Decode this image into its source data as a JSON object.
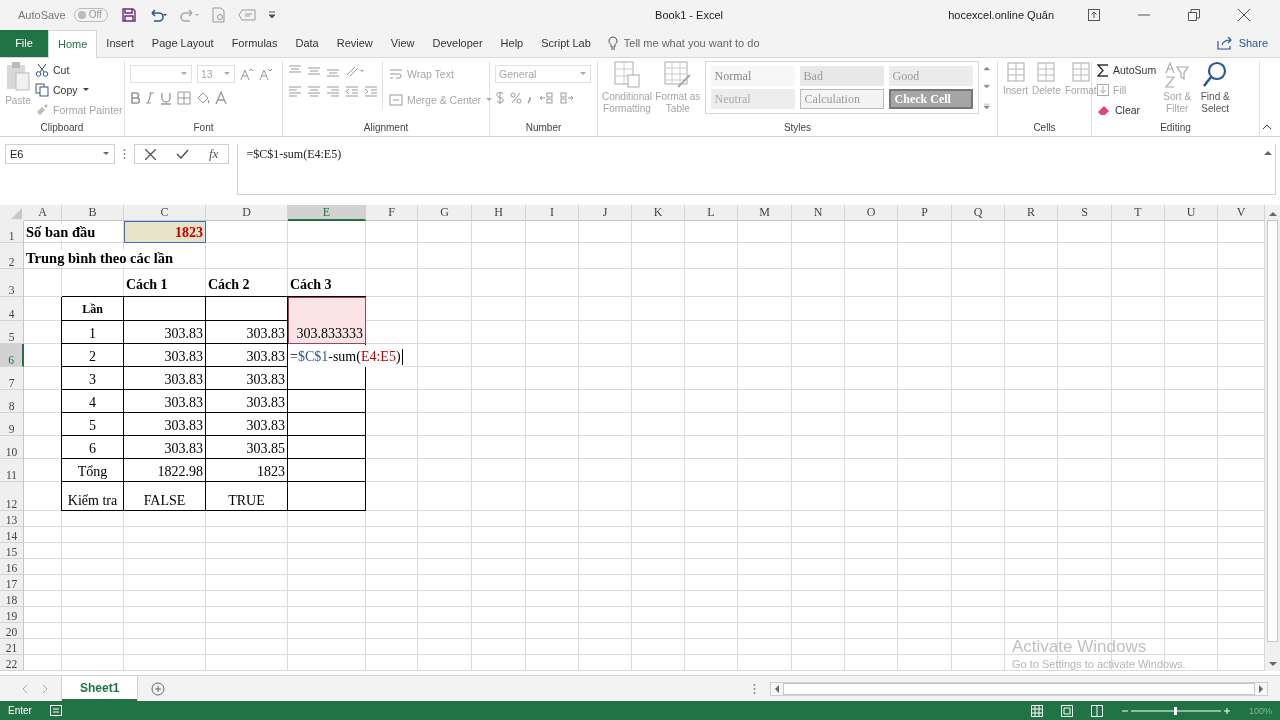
{
  "title_bar": {
    "autosave_label": "AutoSave",
    "autosave_state": "Off",
    "autosave_on": false,
    "document_title": "Book1 - Excel",
    "user": "hocexcel.online Quân"
  },
  "tabs": [
    {
      "label": "File",
      "selected": false,
      "kind": "file"
    },
    {
      "label": "Home",
      "selected": true,
      "kind": "tab"
    },
    {
      "label": "Insert",
      "selected": false,
      "kind": "tab"
    },
    {
      "label": "Page Layout",
      "selected": false,
      "kind": "tab"
    },
    {
      "label": "Formulas",
      "selected": false,
      "kind": "tab"
    },
    {
      "label": "Data",
      "selected": false,
      "kind": "tab"
    },
    {
      "label": "Review",
      "selected": false,
      "kind": "tab"
    },
    {
      "label": "View",
      "selected": false,
      "kind": "tab"
    },
    {
      "label": "Developer",
      "selected": false,
      "kind": "tab"
    },
    {
      "label": "Help",
      "selected": false,
      "kind": "tab"
    },
    {
      "label": "Script Lab",
      "selected": false,
      "kind": "tab"
    }
  ],
  "tell_me": {
    "placeholder": "Tell me what you want to do"
  },
  "share": "Share",
  "ribbon": {
    "clipboard": {
      "label": "Clipboard",
      "paste": {
        "label": "Paste",
        "disabled": true
      },
      "cut": {
        "label": "Cut",
        "disabled": false
      },
      "copy": {
        "label": "Copy",
        "disabled": false
      },
      "format_painter": {
        "label": "Format Painter",
        "disabled": true
      }
    },
    "font": {
      "label": "Font",
      "size": "13",
      "disabled": true
    },
    "alignment": {
      "label": "Alignment",
      "wrap_text": "Wrap Text",
      "merge": "Merge & Center",
      "disabled": true
    },
    "number": {
      "label": "Number",
      "format": "General",
      "disabled": true
    },
    "styles": {
      "label": "Styles",
      "conditional": "Conditional Formatting",
      "format_table": "Format as Table",
      "disabled": true,
      "cell_styles": [
        {
          "label": "Normal",
          "kind": "normal"
        },
        {
          "label": "Bad",
          "kind": "bad"
        },
        {
          "label": "Good",
          "kind": "good"
        },
        {
          "label": "Neutral",
          "kind": "neutral"
        },
        {
          "label": "Calculation",
          "kind": "calculation"
        },
        {
          "label": "Check Cell",
          "kind": "check"
        }
      ]
    },
    "cells": {
      "label": "Cells",
      "items": [
        "Insert",
        "Delete",
        "Format"
      ],
      "disabled": true
    },
    "editing": {
      "label": "Editing",
      "autosum": {
        "label": "AutoSum",
        "disabled": false
      },
      "fill": {
        "label": "Fill",
        "disabled": true
      },
      "clear": {
        "label": "Clear",
        "disabled": false
      },
      "sort": {
        "label": "Sort & Filter",
        "disabled": true
      },
      "find": {
        "label": "Find & Select",
        "disabled": false
      }
    }
  },
  "formula_bar": {
    "name_box": "E6",
    "function_label": "fx",
    "formula": "=$C$1-sum(E4:E5)"
  },
  "sheet": {
    "columns": [
      {
        "label": "A",
        "selected": false
      },
      {
        "label": "B",
        "selected": false
      },
      {
        "label": "C",
        "selected": false
      },
      {
        "label": "D",
        "selected": false
      },
      {
        "label": "E",
        "selected": true
      },
      {
        "label": "F",
        "selected": false
      },
      {
        "label": "G",
        "selected": false
      },
      {
        "label": "H",
        "selected": false
      },
      {
        "label": "I",
        "selected": false
      },
      {
        "label": "J",
        "selected": false
      },
      {
        "label": "K",
        "selected": false
      },
      {
        "label": "L",
        "selected": false
      },
      {
        "label": "M",
        "selected": false
      },
      {
        "label": "N",
        "selected": false
      },
      {
        "label": "O",
        "selected": false
      },
      {
        "label": "P",
        "selected": false
      },
      {
        "label": "Q",
        "selected": false
      },
      {
        "label": "R",
        "selected": false
      },
      {
        "label": "S",
        "selected": false
      },
      {
        "label": "T",
        "selected": false
      },
      {
        "label": "U",
        "selected": false
      },
      {
        "label": "V",
        "selected": false
      }
    ],
    "rows": [
      {
        "num": "1",
        "selected": false,
        "cells": [
          {
            "kind": "title",
            "text": "Số ban đầu"
          },
          {
            "kind": "blank"
          },
          {
            "kind": "ref",
            "text": "1823"
          }
        ]
      },
      {
        "num": "2",
        "selected": false,
        "cells": [
          {
            "kind": "title",
            "text": "Trung bình theo các lần"
          }
        ]
      },
      {
        "num": "3",
        "selected": false,
        "cells": [
          {
            "kind": "blank"
          },
          {
            "kind": "blank"
          },
          {
            "kind": "heading",
            "text": "Cách 1"
          },
          {
            "kind": "heading",
            "text": "Cách 2"
          },
          {
            "kind": "heading",
            "text": "Cách 3"
          }
        ]
      },
      {
        "num": "4",
        "selected": false,
        "cells": [
          {
            "kind": "blank"
          },
          {
            "kind": "label",
            "text": "Lần"
          },
          {
            "kind": "blank"
          },
          {
            "kind": "blank"
          },
          {
            "kind": "range"
          }
        ]
      },
      {
        "num": "5",
        "selected": false,
        "cells": [
          {
            "kind": "blank"
          },
          {
            "kind": "center",
            "text": "1"
          },
          {
            "kind": "number",
            "text": "303.83"
          },
          {
            "kind": "number",
            "text": "303.83"
          },
          {
            "kind": "range",
            "text": "303.833333"
          }
        ]
      },
      {
        "num": "6",
        "selected": true,
        "cells": [
          {
            "kind": "blank"
          },
          {
            "kind": "center",
            "text": "2"
          },
          {
            "kind": "number",
            "text": "303.83"
          },
          {
            "kind": "number",
            "text": "303.83"
          },
          {
            "kind": "editing",
            "parts": [
              {
                "text": "="
              },
              {
                "text": "$C$1",
                "color": "#2f5597"
              },
              {
                "text": "-sum("
              },
              {
                "text": "E4:E5",
                "color": "#c00000"
              },
              {
                "text": ")"
              }
            ]
          }
        ]
      },
      {
        "num": "7",
        "selected": false,
        "cells": [
          {
            "kind": "blank"
          },
          {
            "kind": "center",
            "text": "3"
          },
          {
            "kind": "number",
            "text": "303.83"
          },
          {
            "kind": "number",
            "text": "303.83"
          }
        ]
      },
      {
        "num": "8",
        "selected": false,
        "cells": [
          {
            "kind": "blank"
          },
          {
            "kind": "center",
            "text": "4"
          },
          {
            "kind": "number",
            "text": "303.83"
          },
          {
            "kind": "number",
            "text": "303.83"
          }
        ]
      },
      {
        "num": "9",
        "selected": false,
        "cells": [
          {
            "kind": "blank"
          },
          {
            "kind": "center",
            "text": "5"
          },
          {
            "kind": "number",
            "text": "303.83"
          },
          {
            "kind": "number",
            "text": "303.83"
          }
        ]
      },
      {
        "num": "10",
        "selected": false,
        "cells": [
          {
            "kind": "blank"
          },
          {
            "kind": "center",
            "text": "6"
          },
          {
            "kind": "number",
            "text": "303.83"
          },
          {
            "kind": "number",
            "text": "303.85"
          }
        ]
      },
      {
        "num": "11",
        "selected": false,
        "cells": [
          {
            "kind": "blank"
          },
          {
            "kind": "center",
            "text": "Tổng"
          },
          {
            "kind": "number",
            "text": "1822.98"
          },
          {
            "kind": "number",
            "text": "1823"
          }
        ]
      },
      {
        "num": "12",
        "selected": false,
        "cells": [
          {
            "kind": "blank"
          },
          {
            "kind": "center",
            "text": "Kiểm tra"
          },
          {
            "kind": "center",
            "text": "FALSE"
          },
          {
            "kind": "center",
            "text": "TRUE"
          }
        ]
      },
      {
        "num": "13",
        "selected": false,
        "cells": []
      },
      {
        "num": "14",
        "selected": false,
        "cells": []
      },
      {
        "num": "15",
        "selected": false,
        "cells": []
      },
      {
        "num": "16",
        "selected": false,
        "cells": []
      },
      {
        "num": "17",
        "selected": false,
        "cells": []
      },
      {
        "num": "18",
        "selected": false,
        "cells": []
      },
      {
        "num": "19",
        "selected": false,
        "cells": []
      },
      {
        "num": "20",
        "selected": false,
        "cells": []
      },
      {
        "num": "21",
        "selected": false,
        "cells": []
      },
      {
        "num": "22",
        "selected": false,
        "cells": []
      }
    ]
  },
  "sheet_tabs": [
    {
      "label": "Sheet1",
      "selected": true
    }
  ],
  "activation": {
    "title": "Activate Windows",
    "subtitle": "Go to Settings to activate Windows."
  },
  "status_bar": {
    "mode": "Enter",
    "zoom": "100%"
  }
}
